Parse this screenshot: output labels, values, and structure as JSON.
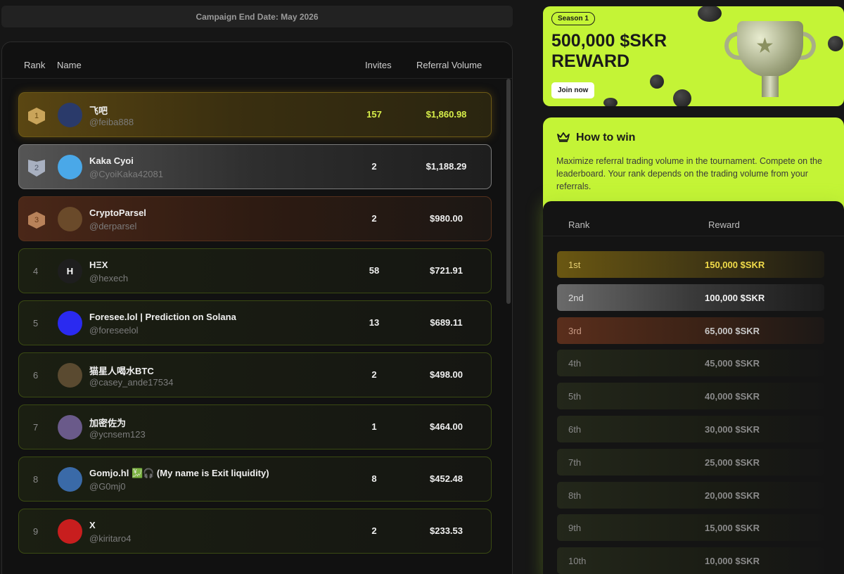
{
  "campaign": {
    "end_date": "Campaign End Date: May 2026"
  },
  "leaderboard": {
    "headers": {
      "rank": "Rank",
      "name": "Name",
      "invites": "Invites",
      "volume": "Referral Volume"
    },
    "rows": [
      {
        "rank": "1",
        "name": "飞吧",
        "handle": "@feiba888",
        "invites": "157",
        "volume": "$1,860.98",
        "avatar_text": "",
        "avatar_color": "#2a3a6a"
      },
      {
        "rank": "2",
        "name": "Kaka Cyoi",
        "handle": "@CyoiKaka42081",
        "invites": "2",
        "volume": "$1,188.29",
        "avatar_text": "",
        "avatar_color": "#4aa8e8"
      },
      {
        "rank": "3",
        "name": "CryptoParsel",
        "handle": "@derparsel",
        "invites": "2",
        "volume": "$980.00",
        "avatar_text": "",
        "avatar_color": "#6a4a2a"
      },
      {
        "rank": "4",
        "name": "HΞX",
        "handle": "@hexech",
        "invites": "58",
        "volume": "$721.91",
        "avatar_text": "H",
        "avatar_color": "#1e1e1e"
      },
      {
        "rank": "5",
        "name": "Foresee.lol | Prediction on Solana",
        "handle": "@foreseelol",
        "invites": "13",
        "volume": "$689.11",
        "avatar_text": "",
        "avatar_color": "#2a2af0"
      },
      {
        "rank": "6",
        "name": "猫星人喝水BTC",
        "handle": "@casey_ande17534",
        "invites": "2",
        "volume": "$498.00",
        "avatar_text": "",
        "avatar_color": "#5a4a30"
      },
      {
        "rank": "7",
        "name": "加密佐为",
        "handle": "@ycnsem123",
        "invites": "1",
        "volume": "$464.00",
        "avatar_text": "",
        "avatar_color": "#6a5a8a"
      },
      {
        "rank": "8",
        "name": "Gomjo.hl 💹🎧 (My name is Exit liquidity)",
        "handle": "@G0mj0",
        "invites": "8",
        "volume": "$452.48",
        "avatar_text": "",
        "avatar_color": "#3a6aa8"
      },
      {
        "rank": "9",
        "name": "X",
        "handle": "@kiritaro4",
        "invites": "2",
        "volume": "$233.53",
        "avatar_text": "",
        "avatar_color": "#c81e1e"
      }
    ]
  },
  "banner": {
    "season": "Season 1",
    "title": "500,000 $SKR REWARD",
    "join_label": "Join now"
  },
  "how_to_win": {
    "title": "How to win",
    "description": "Maximize referral trading volume in the tournament. Compete on the leaderboard. Your rank depends on the trading volume from your referrals.",
    "headers": {
      "rank": "Rank",
      "reward": "Reward"
    },
    "rewards": [
      {
        "rank": "1st",
        "reward": "150,000 $SKR"
      },
      {
        "rank": "2nd",
        "reward": "100,000 $SKR"
      },
      {
        "rank": "3rd",
        "reward": "65,000 $SKR"
      },
      {
        "rank": "4th",
        "reward": "45,000 $SKR"
      },
      {
        "rank": "5th",
        "reward": "40,000 $SKR"
      },
      {
        "rank": "6th",
        "reward": "30,000 $SKR"
      },
      {
        "rank": "7th",
        "reward": "25,000 $SKR"
      },
      {
        "rank": "8th",
        "reward": "20,000 $SKR"
      },
      {
        "rank": "9th",
        "reward": "15,000 $SKR"
      },
      {
        "rank": "10th",
        "reward": "10,000 $SKR"
      }
    ]
  },
  "colors": {
    "accent": "#c4f436",
    "gold": "#d8ef4a"
  }
}
